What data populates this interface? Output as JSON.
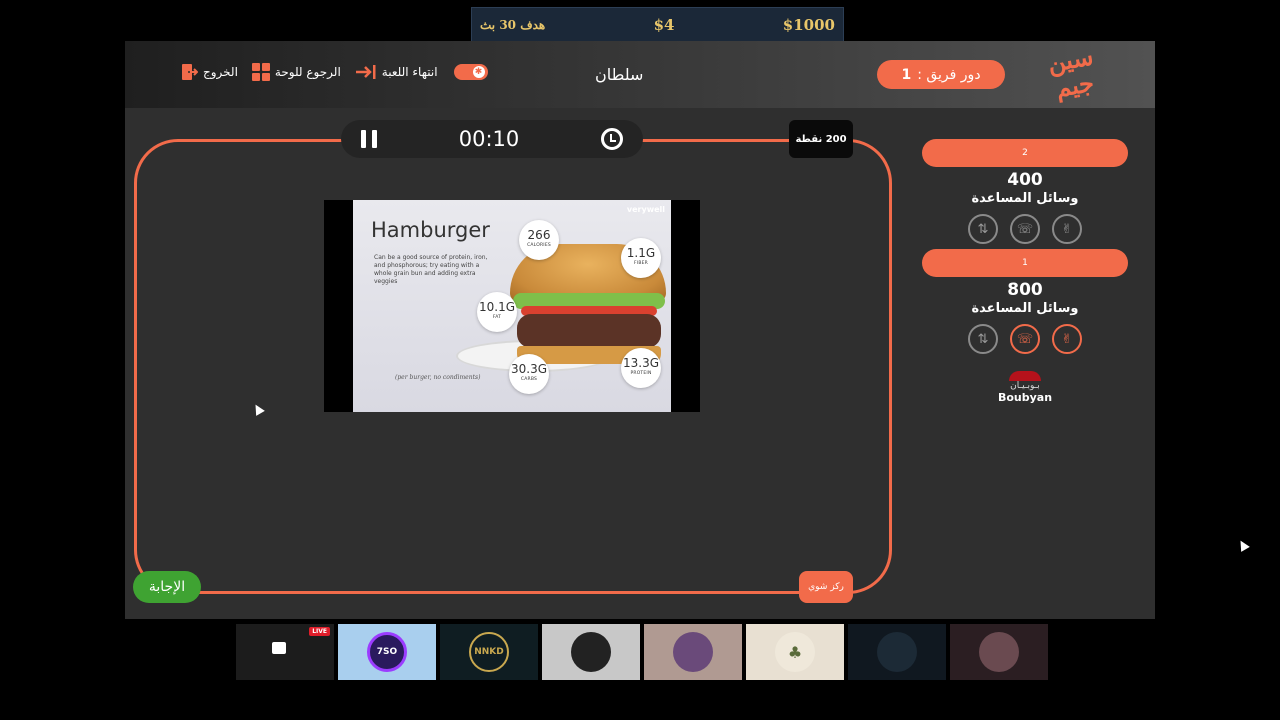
{
  "banner": {
    "prize": "$1000",
    "current": "$4",
    "goal": "هدف 30 بث"
  },
  "header": {
    "exit_label": "الخروج",
    "board_label": "الرجوع للوحة",
    "end_game_label": "انتهاء اللعبة",
    "player_name": "سلطان",
    "turn_label": "دور فريق :",
    "turn_value": "1",
    "logo_line1": "سين",
    "logo_line2": "جيم"
  },
  "question": {
    "timer": "00:10",
    "points": "200 نقطة",
    "answer_label": "الإجابة",
    "focus_label": "ركز شوي",
    "image": {
      "title": "Hamburger",
      "brand": "verywell",
      "description": "Can be a good source of protein, iron, and phosphorous; try eating with a whole grain bun and adding extra veggies",
      "note": "(per burger, no condiments)",
      "nutrients": [
        {
          "value": "266",
          "label": "CALORIES"
        },
        {
          "value": "1.1G",
          "label": "FIBER"
        },
        {
          "value": "10.1G",
          "label": "FAT"
        },
        {
          "value": "30.3G",
          "label": "CARBS"
        },
        {
          "value": "13.3G",
          "label": "PROTEIN"
        }
      ]
    }
  },
  "teams": [
    {
      "name": "2",
      "score": "400",
      "aids_label": "وسائل المساعدة",
      "aids": [
        {
          "icon": "swap-icon",
          "active": false
        },
        {
          "icon": "phone-icon",
          "active": false
        },
        {
          "icon": "hand-icon",
          "active": false
        }
      ]
    },
    {
      "name": "1",
      "score": "800",
      "aids_label": "وسائل المساعدة",
      "aids": [
        {
          "icon": "swap-icon",
          "active": false
        },
        {
          "icon": "phone-icon",
          "active": true
        },
        {
          "icon": "hand-icon",
          "active": true
        }
      ]
    }
  ],
  "sponsor": {
    "arabic": "بـوبـيـان",
    "english": "Boubyan"
  },
  "thumbnails": [
    {
      "name": "stream-thumb-1",
      "live": "LIVE",
      "bg": "#1c1c1c"
    },
    {
      "name": "stream-thumb-2",
      "text": "7SO",
      "bg": "#a9cfee"
    },
    {
      "name": "stream-thumb-3",
      "text": "NNKD",
      "bg": "#0f1d22"
    },
    {
      "name": "stream-thumb-4",
      "text": "",
      "bg": "#c8c8c8"
    },
    {
      "name": "stream-thumb-5",
      "text": "",
      "bg": "#b09a92"
    },
    {
      "name": "stream-thumb-6",
      "text": "",
      "bg": "#e8e0d2"
    },
    {
      "name": "stream-thumb-7",
      "text": "",
      "bg": "#101820"
    },
    {
      "name": "stream-thumb-8",
      "text": "",
      "bg": "#2b1e22"
    }
  ],
  "colors": {
    "accent": "#f26b4a",
    "answer": "#3fa332",
    "panel": "#2f2f2f"
  }
}
